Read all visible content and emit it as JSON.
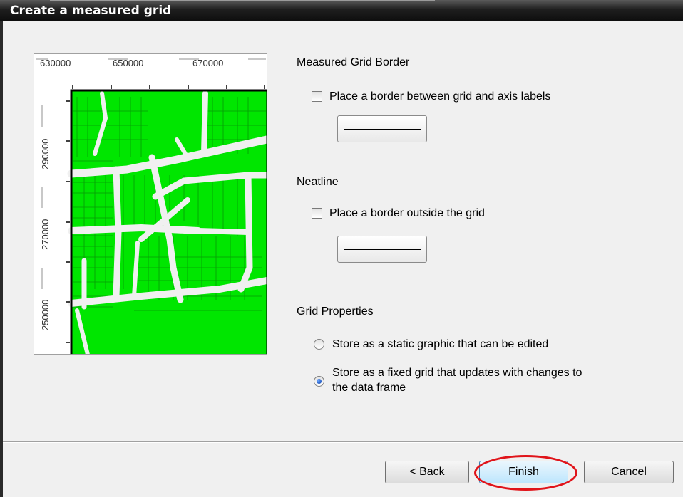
{
  "window": {
    "title": "Create a measured grid"
  },
  "preview": {
    "x_tick_labels": [
      "630000",
      "650000",
      "670000"
    ],
    "y_tick_labels": [
      "290000",
      "270000",
      "250000"
    ],
    "colors": {
      "parcel": "#00e600",
      "road": "#f0f0f0",
      "frame": "#000000"
    }
  },
  "measured_grid_border": {
    "heading": "Measured Grid Border",
    "checkbox_label": "Place a border between grid and axis labels",
    "checked": false
  },
  "neatline": {
    "heading": "Neatline",
    "checkbox_label": "Place a border outside the grid",
    "checked": false
  },
  "grid_properties": {
    "heading": "Grid Properties",
    "options": [
      {
        "label": "Store as a static graphic that can be edited",
        "selected": false
      },
      {
        "label": "Store as a fixed grid that updates with changes to",
        "label_line2": "the data frame",
        "selected": true
      }
    ]
  },
  "buttons": {
    "back": "< Back",
    "finish": "Finish",
    "cancel": "Cancel"
  },
  "annotation": {
    "highlight_color": "#e0141a",
    "target": "Finish"
  }
}
